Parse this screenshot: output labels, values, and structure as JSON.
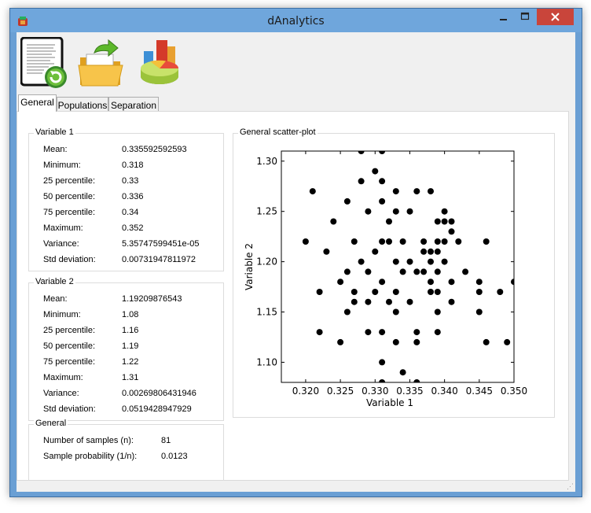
{
  "window": {
    "title": "dAnalytics"
  },
  "toolbar": {
    "items": [
      {
        "name": "reload-document",
        "icon": "document-refresh-icon"
      },
      {
        "name": "open-folder",
        "icon": "open-folder-icon"
      },
      {
        "name": "charts",
        "icon": "charts-icon"
      }
    ]
  },
  "tabs": [
    {
      "label": "General",
      "active": true
    },
    {
      "label": "Populations",
      "active": false
    },
    {
      "label": "Separation",
      "active": false
    }
  ],
  "variable1": {
    "title": "Variable 1",
    "rows": [
      {
        "label": "Mean:",
        "value": "0.335592592593"
      },
      {
        "label": "Minimum:",
        "value": "0.318"
      },
      {
        "label": "25 percentile:",
        "value": "0.33"
      },
      {
        "label": "50 percentile:",
        "value": "0.336"
      },
      {
        "label": "75 percentile:",
        "value": "0.34"
      },
      {
        "label": "Maximum:",
        "value": "0.352"
      },
      {
        "label": "Variance:",
        "value": "5.35747599451e-05"
      },
      {
        "label": "Std deviation:",
        "value": "0.00731947811972"
      }
    ]
  },
  "variable2": {
    "title": "Variable 2",
    "rows": [
      {
        "label": "Mean:",
        "value": "1.19209876543"
      },
      {
        "label": "Minimum:",
        "value": "1.08"
      },
      {
        "label": "25 percentile:",
        "value": "1.16"
      },
      {
        "label": "50 percentile:",
        "value": "1.19"
      },
      {
        "label": "75 percentile:",
        "value": "1.22"
      },
      {
        "label": "Maximum:",
        "value": "1.31"
      },
      {
        "label": "Variance:",
        "value": "0.00269806431946"
      },
      {
        "label": "Std deviation:",
        "value": "0.0519428947929"
      }
    ]
  },
  "general": {
    "title": "General",
    "rows": [
      {
        "label": "Number of samples    (n):",
        "value": "81"
      },
      {
        "label": "Sample probability (1/n):",
        "value": "0.0123"
      }
    ]
  },
  "scatter_group": {
    "title": "General scatter-plot"
  },
  "chart_data": {
    "type": "scatter",
    "title": "",
    "xlabel": "Variable 1",
    "ylabel": "Variable 2",
    "xlim": [
      0.3165,
      0.35
    ],
    "ylim": [
      1.08,
      1.31
    ],
    "xticks": [
      "0.320",
      "0.325",
      "0.330",
      "0.335",
      "0.340",
      "0.345",
      "0.350"
    ],
    "xtick_values": [
      0.32,
      0.325,
      0.33,
      0.335,
      0.34,
      0.345,
      0.35
    ],
    "yticks": [
      "1.10",
      "1.15",
      "1.20",
      "1.25",
      "1.30"
    ],
    "ytick_values": [
      1.1,
      1.15,
      1.2,
      1.25,
      1.3
    ],
    "point_color": "#000000",
    "grid": false,
    "points": [
      [
        0.328,
        1.31
      ],
      [
        0.331,
        1.31
      ],
      [
        0.321,
        1.27
      ],
      [
        0.33,
        1.29
      ],
      [
        0.326,
        1.26
      ],
      [
        0.328,
        1.28
      ],
      [
        0.331,
        1.28
      ],
      [
        0.333,
        1.27
      ],
      [
        0.336,
        1.27
      ],
      [
        0.338,
        1.27
      ],
      [
        0.34,
        1.25
      ],
      [
        0.331,
        1.26
      ],
      [
        0.329,
        1.25
      ],
      [
        0.333,
        1.25
      ],
      [
        0.335,
        1.25
      ],
      [
        0.339,
        1.24
      ],
      [
        0.34,
        1.24
      ],
      [
        0.341,
        1.24
      ],
      [
        0.324,
        1.24
      ],
      [
        0.332,
        1.24
      ],
      [
        0.341,
        1.23
      ],
      [
        0.34,
        1.22
      ],
      [
        0.342,
        1.22
      ],
      [
        0.346,
        1.22
      ],
      [
        0.316,
        1.22
      ],
      [
        0.32,
        1.22
      ],
      [
        0.327,
        1.22
      ],
      [
        0.331,
        1.22
      ],
      [
        0.332,
        1.22
      ],
      [
        0.334,
        1.22
      ],
      [
        0.337,
        1.22
      ],
      [
        0.339,
        1.22
      ],
      [
        0.323,
        1.21
      ],
      [
        0.33,
        1.21
      ],
      [
        0.337,
        1.21
      ],
      [
        0.338,
        1.21
      ],
      [
        0.339,
        1.21
      ],
      [
        0.328,
        1.2
      ],
      [
        0.333,
        1.2
      ],
      [
        0.335,
        1.2
      ],
      [
        0.338,
        1.2
      ],
      [
        0.34,
        1.2
      ],
      [
        0.326,
        1.19
      ],
      [
        0.329,
        1.19
      ],
      [
        0.334,
        1.19
      ],
      [
        0.336,
        1.19
      ],
      [
        0.337,
        1.19
      ],
      [
        0.339,
        1.19
      ],
      [
        0.343,
        1.19
      ],
      [
        0.325,
        1.18
      ],
      [
        0.331,
        1.18
      ],
      [
        0.338,
        1.18
      ],
      [
        0.341,
        1.18
      ],
      [
        0.345,
        1.18
      ],
      [
        0.35,
        1.18
      ],
      [
        0.322,
        1.17
      ],
      [
        0.327,
        1.17
      ],
      [
        0.33,
        1.17
      ],
      [
        0.333,
        1.17
      ],
      [
        0.338,
        1.17
      ],
      [
        0.339,
        1.17
      ],
      [
        0.345,
        1.17
      ],
      [
        0.348,
        1.17
      ],
      [
        0.327,
        1.16
      ],
      [
        0.329,
        1.16
      ],
      [
        0.332,
        1.16
      ],
      [
        0.335,
        1.16
      ],
      [
        0.341,
        1.16
      ],
      [
        0.326,
        1.15
      ],
      [
        0.333,
        1.15
      ],
      [
        0.339,
        1.15
      ],
      [
        0.345,
        1.15
      ],
      [
        0.322,
        1.13
      ],
      [
        0.329,
        1.13
      ],
      [
        0.331,
        1.13
      ],
      [
        0.336,
        1.13
      ],
      [
        0.339,
        1.13
      ],
      [
        0.325,
        1.12
      ],
      [
        0.333,
        1.12
      ],
      [
        0.336,
        1.12
      ],
      [
        0.346,
        1.12
      ],
      [
        0.349,
        1.12
      ],
      [
        0.351,
        1.13
      ],
      [
        0.331,
        1.1
      ],
      [
        0.334,
        1.09
      ],
      [
        0.336,
        1.08
      ],
      [
        0.331,
        1.08
      ]
    ]
  }
}
